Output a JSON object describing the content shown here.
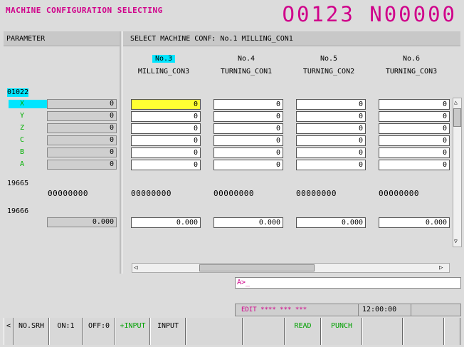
{
  "header": {
    "title": "MACHINE CONFIGURATION SELECTING",
    "program": "O0123 N00000"
  },
  "left": {
    "title": "PARAMETER",
    "param_01022": "01022",
    "axes": [
      {
        "label": "X",
        "value": "0"
      },
      {
        "label": "Y",
        "value": "0"
      },
      {
        "label": "Z",
        "value": "0"
      },
      {
        "label": "C",
        "value": "0"
      },
      {
        "label": "B",
        "value": "0"
      },
      {
        "label": "A",
        "value": "0"
      }
    ],
    "param_19665": "19665",
    "bits_19665": "00000000",
    "param_19666": "19666",
    "value_19666": "0.000"
  },
  "right": {
    "title": "SELECT MACHINE CONF: No.1  MILLING_CON1",
    "columns": [
      {
        "no": "No.3",
        "name": "MILLING_CON3",
        "values": [
          "0",
          "0",
          "0",
          "0",
          "0",
          "0"
        ],
        "bits": "00000000",
        "decimal": "0.000"
      },
      {
        "no": "No.4",
        "name": "TURNING_CON1",
        "values": [
          "0",
          "0",
          "0",
          "0",
          "0",
          "0"
        ],
        "bits": "00000000",
        "decimal": "0.000"
      },
      {
        "no": "No.5",
        "name": "TURNING_CON2",
        "values": [
          "0",
          "0",
          "0",
          "0",
          "0",
          "0"
        ],
        "bits": "00000000",
        "decimal": "0.000"
      },
      {
        "no": "No.6",
        "name": "TURNING_CON3",
        "values": [
          "0",
          "0",
          "0",
          "0",
          "0",
          "0"
        ],
        "bits": "00000000",
        "decimal": "0.000"
      }
    ]
  },
  "command_line": "A>_",
  "status": {
    "mode": "EDIT **** *** ***",
    "time": "12:00:00"
  },
  "softkeys": [
    {
      "label": "<"
    },
    {
      "label": "NO.SRH"
    },
    {
      "label": "ON:1"
    },
    {
      "label": "OFF:0"
    },
    {
      "label": "+INPUT"
    },
    {
      "label": "INPUT"
    },
    {
      "label": ""
    },
    {
      "label": ""
    },
    {
      "label": "READ"
    },
    {
      "label": "PUNCH"
    },
    {
      "label": ""
    },
    {
      "label": ""
    },
    {
      "label": ""
    }
  ],
  "colors": {
    "title": "#d0008a",
    "axis": "#00b000",
    "cursor": "#ffff33",
    "highlight": "#00e5ff",
    "status_text": "#d0008a"
  }
}
